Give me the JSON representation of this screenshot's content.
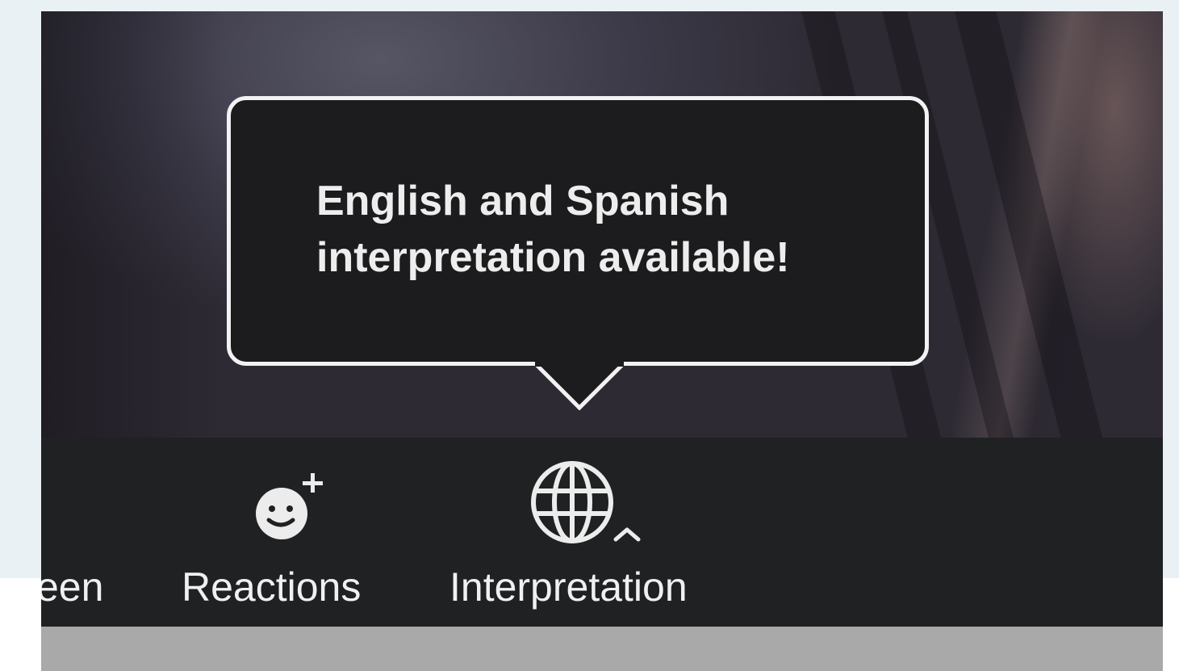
{
  "tooltip": {
    "line1": "English and Spanish",
    "line2": "interpretation available!"
  },
  "toolbar": {
    "partial_label": "een",
    "reactions_label": "Reactions",
    "interpretation_label": "Interpretation"
  },
  "icons": {
    "reactions": "smiley-plus-icon",
    "interpretation": "globe-icon",
    "caret": "chevron-up-icon"
  },
  "colors": {
    "toolbar_bg": "#1f2123",
    "tooltip_bg": "#1c1c1e",
    "tooltip_border": "#f2f2f2",
    "text": "#f0f0f0"
  }
}
